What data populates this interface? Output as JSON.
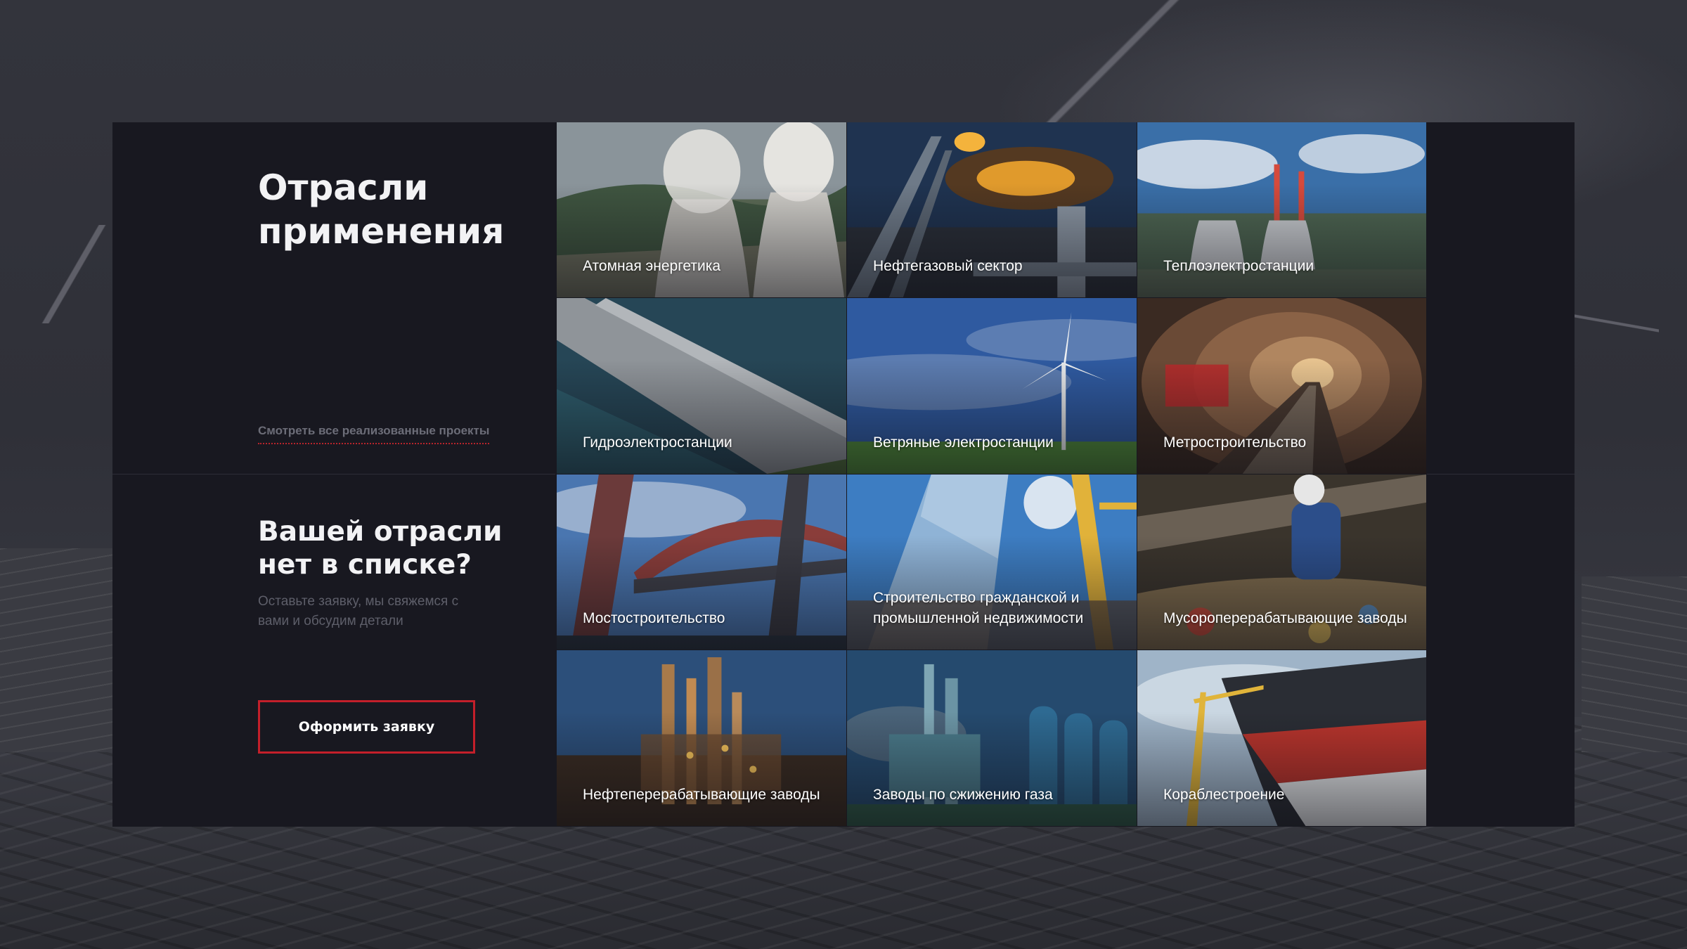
{
  "section": {
    "title": "Отрасли применения",
    "all_projects_link": "Смотреть все реализованные проекты"
  },
  "request": {
    "title": "Вашей отрасли нет в списке?",
    "text": "Оставьте заявку, мы свяжемся с вами и обсудим детали",
    "button_label": "Оформить заявку"
  },
  "industries": [
    {
      "label": "Атомная энергетика",
      "icon": "cooling-towers-photo"
    },
    {
      "label": "Нефтегазовый сектор",
      "icon": "gas-flare-photo"
    },
    {
      "label": "Теплоэлектростанции",
      "icon": "power-plant-photo"
    },
    {
      "label": "Гидроэлектростанции",
      "icon": "dam-photo"
    },
    {
      "label": "Ветряные электростанции",
      "icon": "wind-turbine-photo"
    },
    {
      "label": "Метростроительство",
      "icon": "metro-tunnel-photo"
    },
    {
      "label": "Мостостроительство",
      "icon": "bridge-photo"
    },
    {
      "label": "Строительство гражданской и промышленной недвижимости",
      "icon": "high-rise-construction-photo"
    },
    {
      "label": "Мусороперерабатывающие заводы",
      "icon": "waste-recycling-photo"
    },
    {
      "label": "Нефтеперерабатывающие заводы",
      "icon": "oil-refinery-photo"
    },
    {
      "label": "Заводы по сжижению газа",
      "icon": "lng-plant-photo"
    },
    {
      "label": "Кораблестроение",
      "icon": "shipbuilding-photo"
    }
  ],
  "colors": {
    "panel_bg": "#181820",
    "accent_red": "#c31f2a",
    "heading": "#f2f2f4",
    "muted_text": "#5e5f6a"
  }
}
